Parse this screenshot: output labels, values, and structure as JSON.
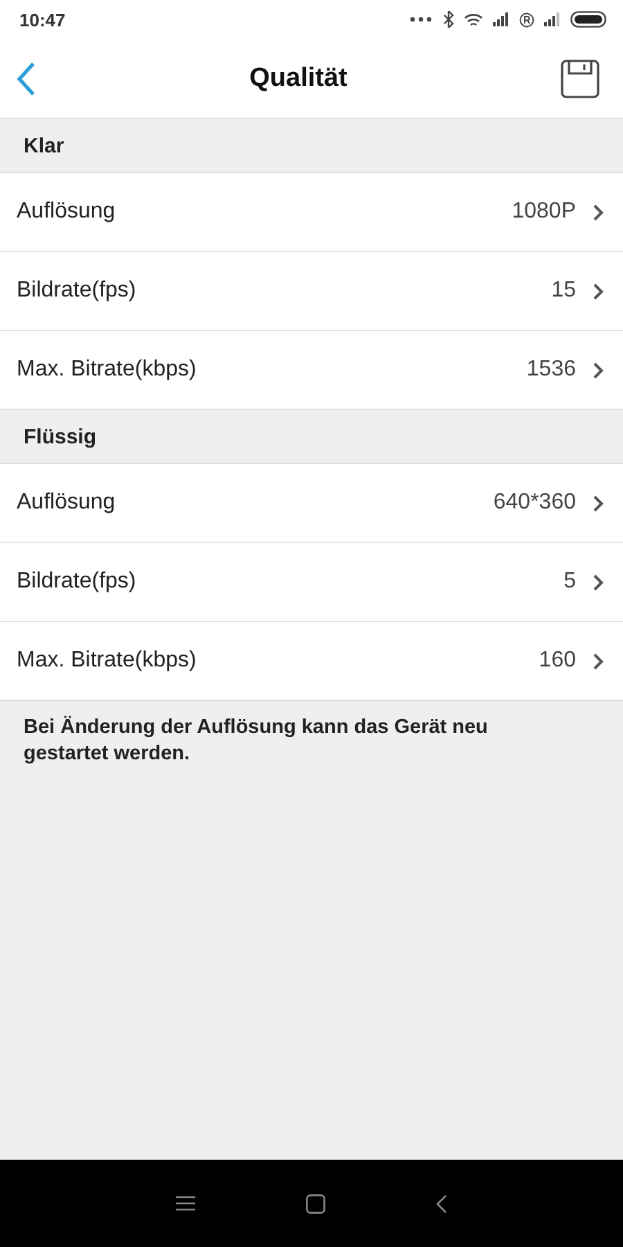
{
  "status_bar": {
    "time": "10:47"
  },
  "header": {
    "title": "Qualität"
  },
  "sections": [
    {
      "title": "Klar",
      "rows": [
        {
          "label": "Auflösung",
          "value": "1080P"
        },
        {
          "label": "Bildrate(fps)",
          "value": "15"
        },
        {
          "label": "Max. Bitrate(kbps)",
          "value": "1536"
        }
      ]
    },
    {
      "title": "Flüssig",
      "rows": [
        {
          "label": "Auflösung",
          "value": "640*360"
        },
        {
          "label": "Bildrate(fps)",
          "value": "5"
        },
        {
          "label": "Max. Bitrate(kbps)",
          "value": "160"
        }
      ]
    }
  ],
  "note": "Bei Änderung der Auflösung kann das Gerät neu gestartet werden."
}
